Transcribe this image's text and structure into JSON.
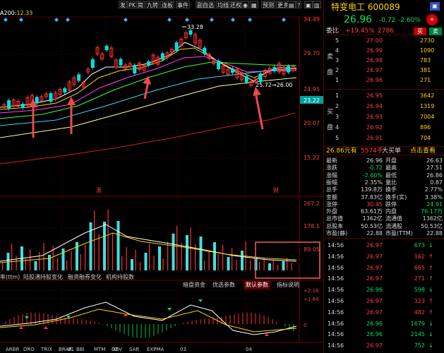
{
  "toolbar": {
    "buttons": [
      "发",
      "PK",
      "简",
      "九转",
      "连板",
      "事件",
      "副自选",
      "均线",
      "还权",
      "",
      "",
      "",
      "",
      "",
      "",
      "",
      "",
      "预测",
      "更多"
    ]
  },
  "ma_label": {
    "prefix": "A200:",
    "value": "12.33"
  },
  "price_axis": [
    "34.49",
    "29.70",
    "24.95",
    "20.07",
    "15.22"
  ],
  "price_labels": {
    "high": "33.28",
    "low": "25.72→26.00",
    "current": "23.22"
  },
  "chart_marks": {
    "a": "涨",
    "b": "财"
  },
  "volume_axis": [
    "267.2",
    "178.1",
    "89.05"
  ],
  "indicator_tabs": [
    "率(ttm)",
    "陆股通持股变化",
    "融资融券变化",
    "机构持股数"
  ],
  "param_tabs": [
    "暗盘资金",
    "优选参数",
    "默认参数",
    "指标说明"
  ],
  "macd_axis": [
    "+2.16",
    "+1.64",
    "0"
  ],
  "bottom_tabs": [
    "ARBR",
    "DRO",
    "TRIX",
    "BRAR",
    "BBI",
    "MTM",
    "OBV",
    "SAR",
    "EXPMA"
  ],
  "months": [
    "01",
    "02",
    "03",
    "04"
  ],
  "quote": {
    "name": "特变电工",
    "code": "600089",
    "price": "26.96",
    "change": "-0.72",
    "change_pct": "-2.60%",
    "webi_label": "委比",
    "webi_value": "+19.45%",
    "webi_count": "2786",
    "buy_btn": "买",
    "sell_btn": "卖",
    "sell_label": "卖盘",
    "buy_label": "买盘",
    "asks": [
      {
        "level": "5",
        "price": "27.00",
        "vol": "2730"
      },
      {
        "level": "4",
        "price": "26.99",
        "vol": "1090"
      },
      {
        "level": "3",
        "price": "26.98",
        "vol": "783"
      },
      {
        "level": "2",
        "price": "26.97",
        "vol": "381"
      },
      {
        "level": "1",
        "price": "26.96",
        "vol": "271"
      }
    ],
    "bids": [
      {
        "level": "1",
        "price": "26.95",
        "vol": "3642"
      },
      {
        "level": "2",
        "price": "26.94",
        "vol": "1319"
      },
      {
        "level": "3",
        "price": "26.93",
        "vol": "7004"
      },
      {
        "level": "4",
        "price": "26.92",
        "vol": "896"
      },
      {
        "level": "5",
        "price": "26.91",
        "vol": "704"
      }
    ],
    "summary": {
      "price": "26.86元有",
      "vol": "5574手",
      "buy": "大买单",
      "link": "点击查看"
    },
    "stats": [
      [
        "最新",
        "26.96",
        "开盘",
        "26.63"
      ],
      [
        "涨跌",
        "-0.72",
        "最高",
        "27.51"
      ],
      [
        "涨幅",
        "-2.60%",
        "最低",
        "26.86"
      ],
      [
        "振幅",
        "2.35%",
        "量比",
        "0.87"
      ],
      [
        "总手",
        "139.8万",
        "换手",
        "2.77%"
      ],
      [
        "金额",
        "37.83亿",
        "换手(实)",
        "3.38%"
      ],
      [
        "涨停",
        "30.45",
        "跌停",
        "24.91"
      ],
      [
        "外盘",
        "63.61万",
        "内盘",
        "76.17万"
      ],
      [
        "总市值",
        "1362亿",
        "流通值",
        "1362亿"
      ],
      [
        "总股本",
        "50.53亿",
        "流通股",
        "50.53亿"
      ],
      [
        "市盈(静)",
        "22.88",
        "市盈(TTM)",
        "22.88"
      ]
    ],
    "ticks": [
      {
        "time": "14:56",
        "price": "26.97",
        "vol": "673",
        "dir": "down"
      },
      {
        "time": "14:56",
        "price": "26.97",
        "vol": "162",
        "dir": "up"
      },
      {
        "time": "14:56",
        "price": "26.97",
        "vol": "665",
        "dir": "up"
      },
      {
        "time": "14:56",
        "price": "26.97",
        "vol": "271",
        "dir": "up"
      },
      {
        "time": "14:56",
        "price": "26.96",
        "vol": "598",
        "dir": "down"
      },
      {
        "time": "14:56",
        "price": "26.97",
        "vol": "323",
        "dir": "up"
      },
      {
        "time": "14:56",
        "price": "26.97",
        "vol": "482",
        "dir": "up"
      },
      {
        "time": "14:56",
        "price": "26.96",
        "vol": "1679",
        "dir": "down"
      },
      {
        "time": "14:56",
        "price": "26.96",
        "vol": "2145",
        "dir": "down"
      },
      {
        "time": "14:56",
        "price": "26.97",
        "vol": "752",
        "dir": "down"
      }
    ]
  },
  "colors": {
    "up": "#ff3030",
    "down": "#00e0e0",
    "bg": "#000000",
    "accent": "#ffd400",
    "sell_red": "#c00000"
  }
}
